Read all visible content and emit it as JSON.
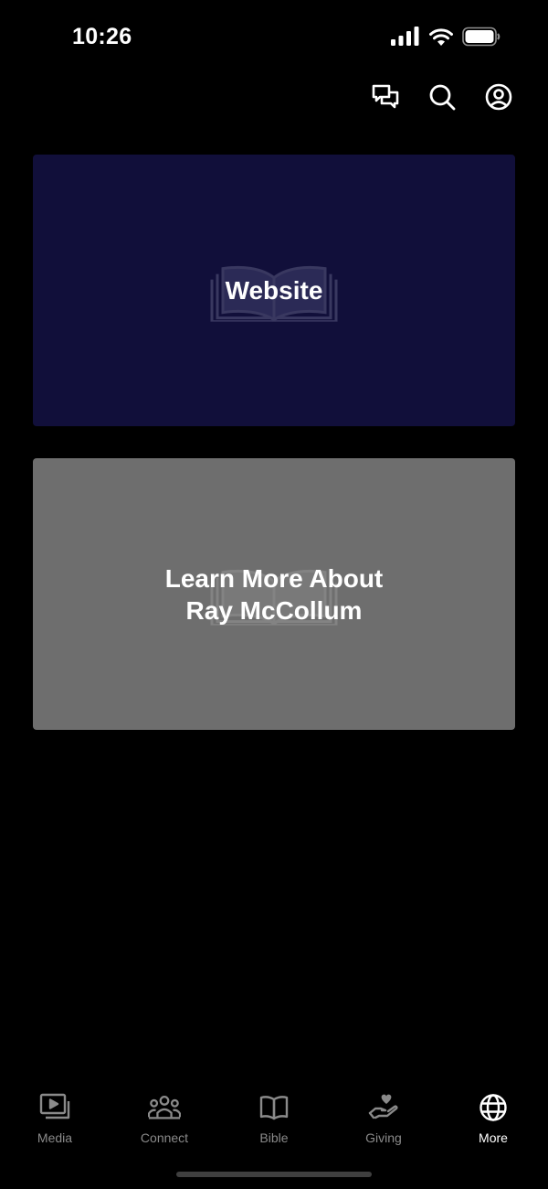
{
  "status_bar": {
    "time": "10:26",
    "icons": [
      "signal-icon",
      "wifi-icon",
      "battery-icon"
    ]
  },
  "header": {
    "actions": [
      {
        "name": "chat-icon",
        "label": "Messages"
      },
      {
        "name": "search-icon",
        "label": "Search"
      },
      {
        "name": "profile-icon",
        "label": "Profile"
      }
    ]
  },
  "cards": [
    {
      "title": "Website",
      "background": "#110f3a",
      "watermark": "open-book-icon"
    },
    {
      "title": "Learn More About\nRay McCollum",
      "background": "#6e6e6e",
      "watermark": "open-book-icon"
    }
  ],
  "tab_bar": {
    "active": "More",
    "active_color": "#ffffff",
    "inactive_color": "#8a8a8a",
    "tabs": [
      {
        "label": "Media",
        "icon": "media-icon"
      },
      {
        "label": "Connect",
        "icon": "people-icon"
      },
      {
        "label": "Bible",
        "icon": "book-icon"
      },
      {
        "label": "Giving",
        "icon": "giving-hand-icon"
      },
      {
        "label": "More",
        "icon": "globe-icon"
      }
    ]
  }
}
